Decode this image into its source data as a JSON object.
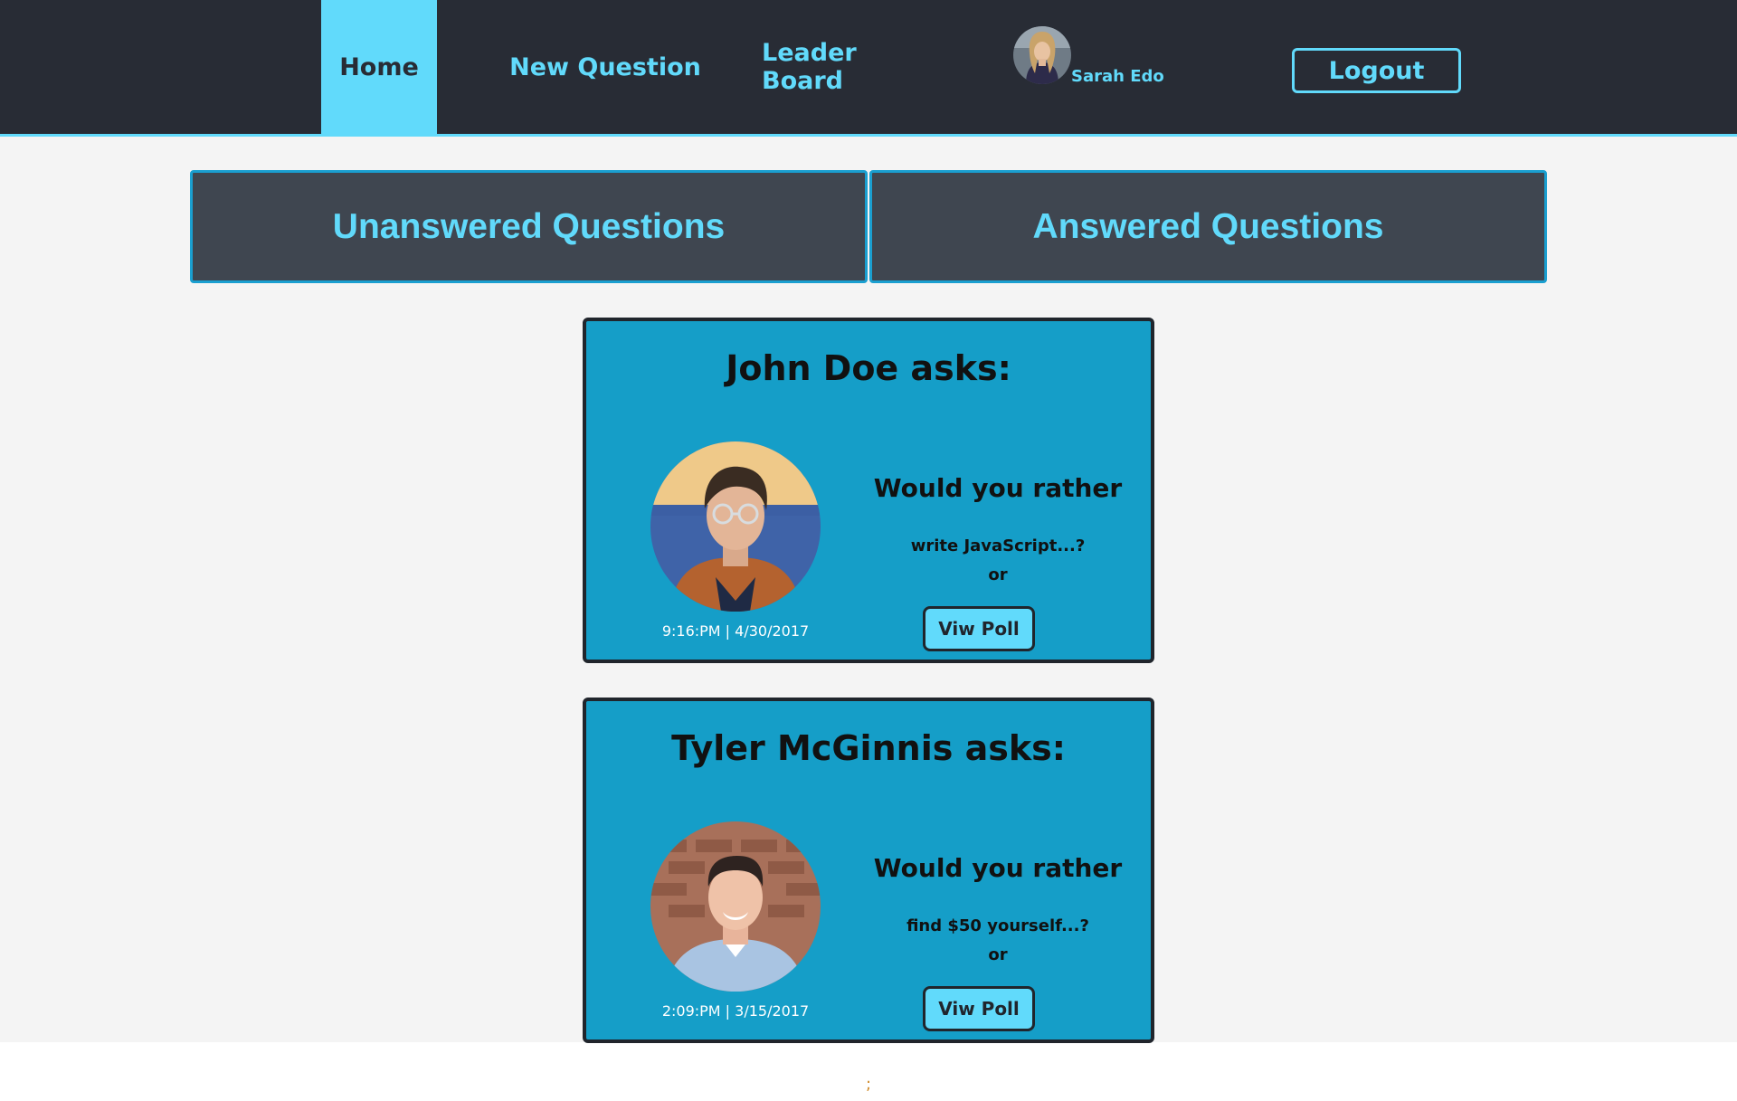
{
  "nav": {
    "home": "Home",
    "new_question": "New Question",
    "leader_board": "Leader Board",
    "user_name": "Sarah Edo",
    "logout": "Logout"
  },
  "tabs": {
    "unanswered": "Unanswered Questions",
    "answered": "Answered Questions"
  },
  "questions": [
    {
      "author_title": "John Doe asks:",
      "timestamp": "9:16:PM | 4/30/2017",
      "prompt": "Would you rather",
      "option_preview": "write JavaScript...?",
      "or_label": "or",
      "button_label": "Viw Poll"
    },
    {
      "author_title": "Tyler McGinnis asks:",
      "timestamp": "2:09:PM | 3/15/2017",
      "prompt": "Would you rather",
      "option_preview": "find $50 yourself...?",
      "or_label": "or",
      "button_label": "Viw Poll"
    }
  ],
  "footer": {
    "stray_text": ";"
  },
  "colors": {
    "nav_bg": "#282c35",
    "accent": "#61dafb",
    "card_bg": "#159ec8",
    "tab_bg": "#3f4650",
    "page_bg": "#f4f4f4"
  },
  "icons": {
    "nav_avatar": "user-avatar-sarah",
    "card_avatar_1": "user-avatar-john",
    "card_avatar_2": "user-avatar-tyler"
  }
}
